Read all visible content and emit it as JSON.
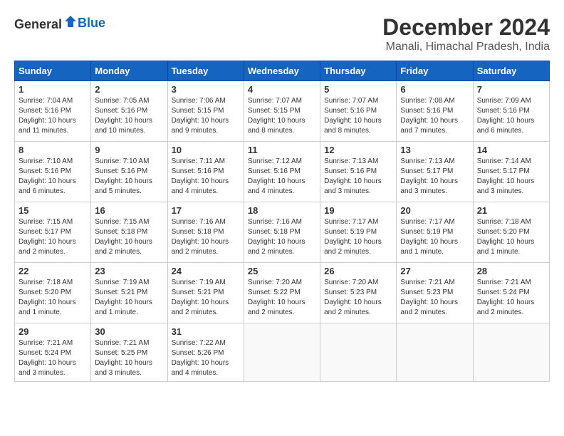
{
  "logo": {
    "general": "General",
    "blue": "Blue"
  },
  "title": {
    "month": "December 2024",
    "location": "Manali, Himachal Pradesh, India"
  },
  "weekdays": [
    "Sunday",
    "Monday",
    "Tuesday",
    "Wednesday",
    "Thursday",
    "Friday",
    "Saturday"
  ],
  "weeks": [
    [
      {
        "day": "1",
        "info": "Sunrise: 7:04 AM\nSunset: 5:16 PM\nDaylight: 10 hours\nand 11 minutes."
      },
      {
        "day": "2",
        "info": "Sunrise: 7:05 AM\nSunset: 5:16 PM\nDaylight: 10 hours\nand 10 minutes."
      },
      {
        "day": "3",
        "info": "Sunrise: 7:06 AM\nSunset: 5:15 PM\nDaylight: 10 hours\nand 9 minutes."
      },
      {
        "day": "4",
        "info": "Sunrise: 7:07 AM\nSunset: 5:15 PM\nDaylight: 10 hours\nand 8 minutes."
      },
      {
        "day": "5",
        "info": "Sunrise: 7:07 AM\nSunset: 5:16 PM\nDaylight: 10 hours\nand 8 minutes."
      },
      {
        "day": "6",
        "info": "Sunrise: 7:08 AM\nSunset: 5:16 PM\nDaylight: 10 hours\nand 7 minutes."
      },
      {
        "day": "7",
        "info": "Sunrise: 7:09 AM\nSunset: 5:16 PM\nDaylight: 10 hours\nand 6 minutes."
      }
    ],
    [
      {
        "day": "8",
        "info": "Sunrise: 7:10 AM\nSunset: 5:16 PM\nDaylight: 10 hours\nand 6 minutes."
      },
      {
        "day": "9",
        "info": "Sunrise: 7:10 AM\nSunset: 5:16 PM\nDaylight: 10 hours\nand 5 minutes."
      },
      {
        "day": "10",
        "info": "Sunrise: 7:11 AM\nSunset: 5:16 PM\nDaylight: 10 hours\nand 4 minutes."
      },
      {
        "day": "11",
        "info": "Sunrise: 7:12 AM\nSunset: 5:16 PM\nDaylight: 10 hours\nand 4 minutes."
      },
      {
        "day": "12",
        "info": "Sunrise: 7:13 AM\nSunset: 5:16 PM\nDaylight: 10 hours\nand 3 minutes."
      },
      {
        "day": "13",
        "info": "Sunrise: 7:13 AM\nSunset: 5:17 PM\nDaylight: 10 hours\nand 3 minutes."
      },
      {
        "day": "14",
        "info": "Sunrise: 7:14 AM\nSunset: 5:17 PM\nDaylight: 10 hours\nand 3 minutes."
      }
    ],
    [
      {
        "day": "15",
        "info": "Sunrise: 7:15 AM\nSunset: 5:17 PM\nDaylight: 10 hours\nand 2 minutes."
      },
      {
        "day": "16",
        "info": "Sunrise: 7:15 AM\nSunset: 5:18 PM\nDaylight: 10 hours\nand 2 minutes."
      },
      {
        "day": "17",
        "info": "Sunrise: 7:16 AM\nSunset: 5:18 PM\nDaylight: 10 hours\nand 2 minutes."
      },
      {
        "day": "18",
        "info": "Sunrise: 7:16 AM\nSunset: 5:18 PM\nDaylight: 10 hours\nand 2 minutes."
      },
      {
        "day": "19",
        "info": "Sunrise: 7:17 AM\nSunset: 5:19 PM\nDaylight: 10 hours\nand 2 minutes."
      },
      {
        "day": "20",
        "info": "Sunrise: 7:17 AM\nSunset: 5:19 PM\nDaylight: 10 hours\nand 1 minute."
      },
      {
        "day": "21",
        "info": "Sunrise: 7:18 AM\nSunset: 5:20 PM\nDaylight: 10 hours\nand 1 minute."
      }
    ],
    [
      {
        "day": "22",
        "info": "Sunrise: 7:18 AM\nSunset: 5:20 PM\nDaylight: 10 hours\nand 1 minute."
      },
      {
        "day": "23",
        "info": "Sunrise: 7:19 AM\nSunset: 5:21 PM\nDaylight: 10 hours\nand 1 minute."
      },
      {
        "day": "24",
        "info": "Sunrise: 7:19 AM\nSunset: 5:21 PM\nDaylight: 10 hours\nand 2 minutes."
      },
      {
        "day": "25",
        "info": "Sunrise: 7:20 AM\nSunset: 5:22 PM\nDaylight: 10 hours\nand 2 minutes."
      },
      {
        "day": "26",
        "info": "Sunrise: 7:20 AM\nSunset: 5:23 PM\nDaylight: 10 hours\nand 2 minutes."
      },
      {
        "day": "27",
        "info": "Sunrise: 7:21 AM\nSunset: 5:23 PM\nDaylight: 10 hours\nand 2 minutes."
      },
      {
        "day": "28",
        "info": "Sunrise: 7:21 AM\nSunset: 5:24 PM\nDaylight: 10 hours\nand 2 minutes."
      }
    ],
    [
      {
        "day": "29",
        "info": "Sunrise: 7:21 AM\nSunset: 5:24 PM\nDaylight: 10 hours\nand 3 minutes."
      },
      {
        "day": "30",
        "info": "Sunrise: 7:21 AM\nSunset: 5:25 PM\nDaylight: 10 hours\nand 3 minutes."
      },
      {
        "day": "31",
        "info": "Sunrise: 7:22 AM\nSunset: 5:26 PM\nDaylight: 10 hours\nand 4 minutes."
      },
      {
        "day": "",
        "info": ""
      },
      {
        "day": "",
        "info": ""
      },
      {
        "day": "",
        "info": ""
      },
      {
        "day": "",
        "info": ""
      }
    ]
  ]
}
